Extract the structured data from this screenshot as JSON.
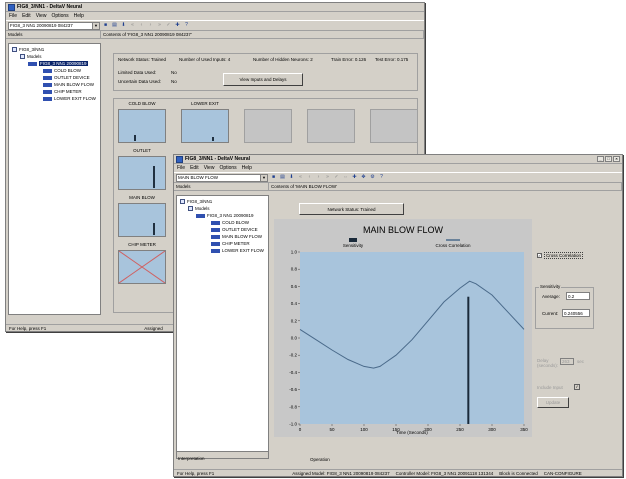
{
  "back_window": {
    "title": "FIG8_3/NN1 - DeltaV Neural",
    "menu": [
      "File",
      "Edit",
      "View",
      "Options",
      "Help"
    ],
    "selector_value": "FIG8_3 NN1 20090819 084237",
    "strip_left": "Models",
    "strip_right": "Contents of 'FIG8_3 NN1 20090819 084237'",
    "tree": [
      "FIG8_3/NN1",
      "Models",
      "FIG8_3 NN1 20090819",
      "COLD BLOW",
      "OUTLET DEVICE",
      "MAIN BLOW FLOW",
      "CHIP METER",
      "LOWER EXIT FLOW"
    ],
    "info": {
      "network_status": "Network Status: Trained",
      "used_inputs": "Number of Used Inputs: 4",
      "hidden_neurons": "Number of Hidden Neurons: 2",
      "train_error": "Train Error: 0.126",
      "test_error": "Test Error: 0.175",
      "limited_label": "Limited Data Used:",
      "limited_value": "No",
      "uncertain_label": "Uncertain Data Used:",
      "uncertain_value": "No",
      "view_button": "View Inputs and Delays"
    },
    "tiles": [
      "COLD BLOW",
      "LOWER EXIT",
      "OUTLET",
      "MAIN BLOW",
      "CHIP METER"
    ],
    "status_left": "For Help, press F1",
    "status_right": "Assigned"
  },
  "front_window": {
    "title": "FIG8_3/NN1 - DeltaV Neural",
    "menu": [
      "File",
      "Edit",
      "View",
      "Options",
      "Help"
    ],
    "selector_value": "MAIN BLOW FLOW",
    "strip_left": "Models",
    "strip_right": "Contents of 'MAIN BLOW FLOW'",
    "tree": [
      "FIG8_3/NN1",
      "Models",
      "FIG8_3 NN1 20090819",
      "COLD BLOW",
      "OUTLET DEVICE",
      "MAIN BLOW FLOW",
      "CHIP METER",
      "LOWER EXIT FLOW"
    ],
    "network_status": "Network Status: Trained",
    "cross_correlation_checkbox": "Cross Correlation",
    "sensitivity_group": "Sensitivity",
    "average_label": "Average:",
    "average_value": "0.2",
    "current_label": "Current:",
    "current_value": "0.240556",
    "delay_label": "Delay (seconds):",
    "delay_value": "263",
    "delay_unit": "sec",
    "include_input_label": "Include Input",
    "update_button": "Update",
    "bottom_tabs": [
      "Interpretation",
      "Operation"
    ],
    "status": {
      "help": "For Help, press F1",
      "assigned_model": "Assigned Model: FIG8_3 NN1 20090819 084237",
      "controller_model": "Controller Model: FIG8_3 NN1 20091118 131344",
      "connection": "Block is Connected",
      "node": "CAN-CONFIGURE"
    }
  },
  "chart_data": {
    "type": "line",
    "title": "MAIN BLOW FLOW",
    "xlabel": "Time (Seconds)",
    "ylabel": "",
    "xlim": [
      0,
      350
    ],
    "ylim": [
      -1.0,
      1.0
    ],
    "x_ticks": [
      0,
      50,
      100,
      150,
      200,
      250,
      300,
      350
    ],
    "y_ticks": [
      1.0,
      0.8,
      0.6,
      0.4,
      0.2,
      0.0,
      -0.2,
      -0.4,
      -0.6,
      -0.8,
      -1.0
    ],
    "grid": false,
    "legend_position": "top",
    "series": [
      {
        "name": "Sensitivity",
        "style": "bar",
        "color": "#1a2a3a",
        "x": [
          263
        ],
        "values": [
          0.48
        ]
      },
      {
        "name": "Cross Correlation",
        "style": "line",
        "color": "#4a6a8a",
        "x": [
          0,
          25,
          50,
          75,
          100,
          115,
          125,
          150,
          175,
          200,
          225,
          250,
          265,
          275,
          300,
          325,
          350
        ],
        "values": [
          0.1,
          -0.02,
          -0.14,
          -0.25,
          -0.33,
          -0.35,
          -0.33,
          -0.2,
          -0.02,
          0.2,
          0.42,
          0.58,
          0.66,
          0.63,
          0.5,
          0.3,
          0.1
        ]
      }
    ]
  },
  "colors": {
    "plot_bg": "#a8c4dc",
    "window_bg": "#d4d0c8",
    "selection": "#0a246a"
  }
}
